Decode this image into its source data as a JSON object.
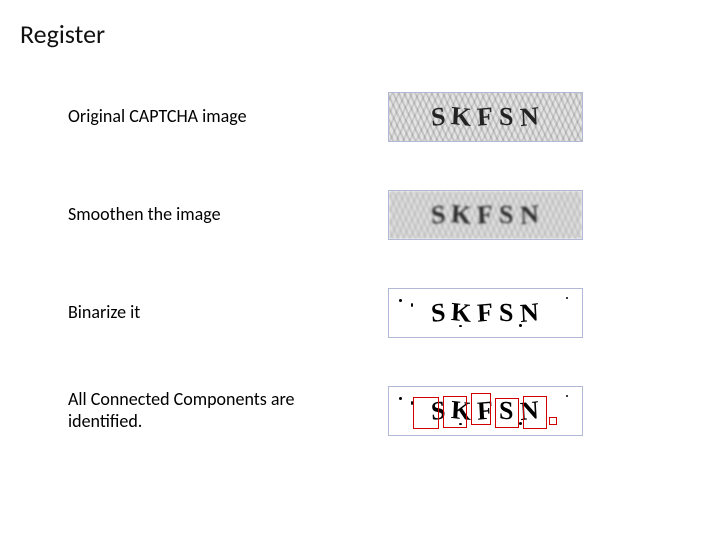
{
  "title": "Register",
  "rows": [
    {
      "label": "Original CAPTCHA image"
    },
    {
      "label": "Smoothen the image"
    },
    {
      "label": "Binarize it"
    },
    {
      "label": "All Connected Components are identified."
    }
  ],
  "captcha": {
    "chars": [
      "S",
      "K",
      "F",
      "S",
      "N"
    ]
  }
}
